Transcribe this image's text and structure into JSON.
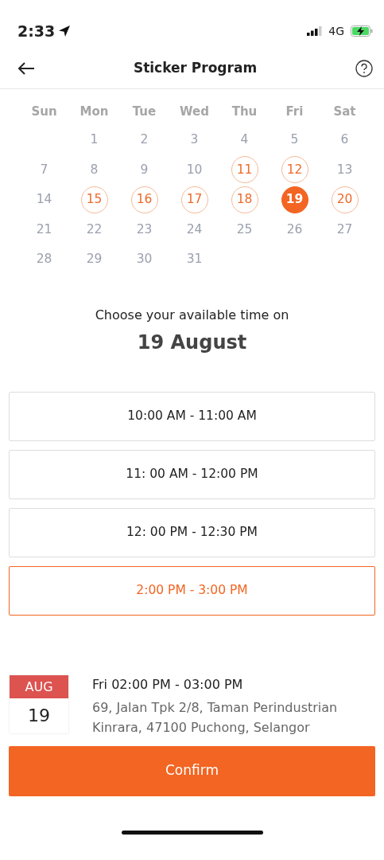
{
  "status_bar": {
    "time": "2:33",
    "network": "4G"
  },
  "header": {
    "title": "Sticker Program"
  },
  "calendar": {
    "weekdays": [
      "Sun",
      "Mon",
      "Tue",
      "Wed",
      "Thu",
      "Fri",
      "Sat"
    ],
    "weeks": [
      {
        "days": [
          {
            "label": "1",
            "available": false,
            "selected": false
          },
          {
            "label": "2",
            "available": false,
            "selected": false
          },
          {
            "label": "3",
            "available": false,
            "selected": false
          },
          {
            "label": "4",
            "available": false,
            "selected": false
          },
          {
            "label": "5",
            "available": false,
            "selected": false
          },
          {
            "label": "6",
            "available": false,
            "selected": false
          }
        ]
      },
      {
        "days": [
          {
            "label": "7",
            "available": false,
            "selected": false
          },
          {
            "label": "8",
            "available": false,
            "selected": false
          },
          {
            "label": "9",
            "available": false,
            "selected": false
          },
          {
            "label": "10",
            "available": false,
            "selected": false
          },
          {
            "label": "11",
            "available": true,
            "selected": false
          },
          {
            "label": "12",
            "available": true,
            "selected": false
          },
          {
            "label": "13",
            "available": false,
            "selected": false
          }
        ]
      },
      {
        "days": [
          {
            "label": "14",
            "available": false,
            "selected": false
          },
          {
            "label": "15",
            "available": true,
            "selected": false
          },
          {
            "label": "16",
            "available": true,
            "selected": false
          },
          {
            "label": "17",
            "available": true,
            "selected": false
          },
          {
            "label": "18",
            "available": true,
            "selected": false
          },
          {
            "label": "19",
            "available": true,
            "selected": true
          },
          {
            "label": "20",
            "available": true,
            "selected": false
          }
        ]
      },
      {
        "days": [
          {
            "label": "21",
            "available": false,
            "selected": false
          },
          {
            "label": "22",
            "available": false,
            "selected": false
          },
          {
            "label": "23",
            "available": false,
            "selected": false
          },
          {
            "label": "24",
            "available": false,
            "selected": false
          },
          {
            "label": "25",
            "available": false,
            "selected": false
          },
          {
            "label": "26",
            "available": false,
            "selected": false
          },
          {
            "label": "27",
            "available": false,
            "selected": false
          }
        ]
      },
      {
        "days": [
          {
            "label": "28",
            "available": false,
            "selected": false
          },
          {
            "label": "29",
            "available": false,
            "selected": false
          },
          {
            "label": "30",
            "available": false,
            "selected": false
          },
          {
            "label": "31",
            "available": false,
            "selected": false
          }
        ]
      }
    ]
  },
  "prompt": "Choose your available time on",
  "chosen_date": "19 August",
  "time_slots": [
    {
      "label": "10:00 AM - 11:00 AM",
      "selected": false
    },
    {
      "label": "11: 00 AM - 12:00 PM",
      "selected": false
    },
    {
      "label": "12: 00 PM - 12:30 PM",
      "selected": false
    },
    {
      "label": "2:00 PM - 3:00 PM",
      "selected": true
    }
  ],
  "summary": {
    "month": "AUG",
    "day": "19",
    "time": "Fri 02:00 PM - 03:00 PM",
    "address": "69, Jalan Tpk 2/8, Taman Perindustrian Kinrara, 47100 Puchong, Selangor"
  },
  "confirm_button": "Confirm"
}
